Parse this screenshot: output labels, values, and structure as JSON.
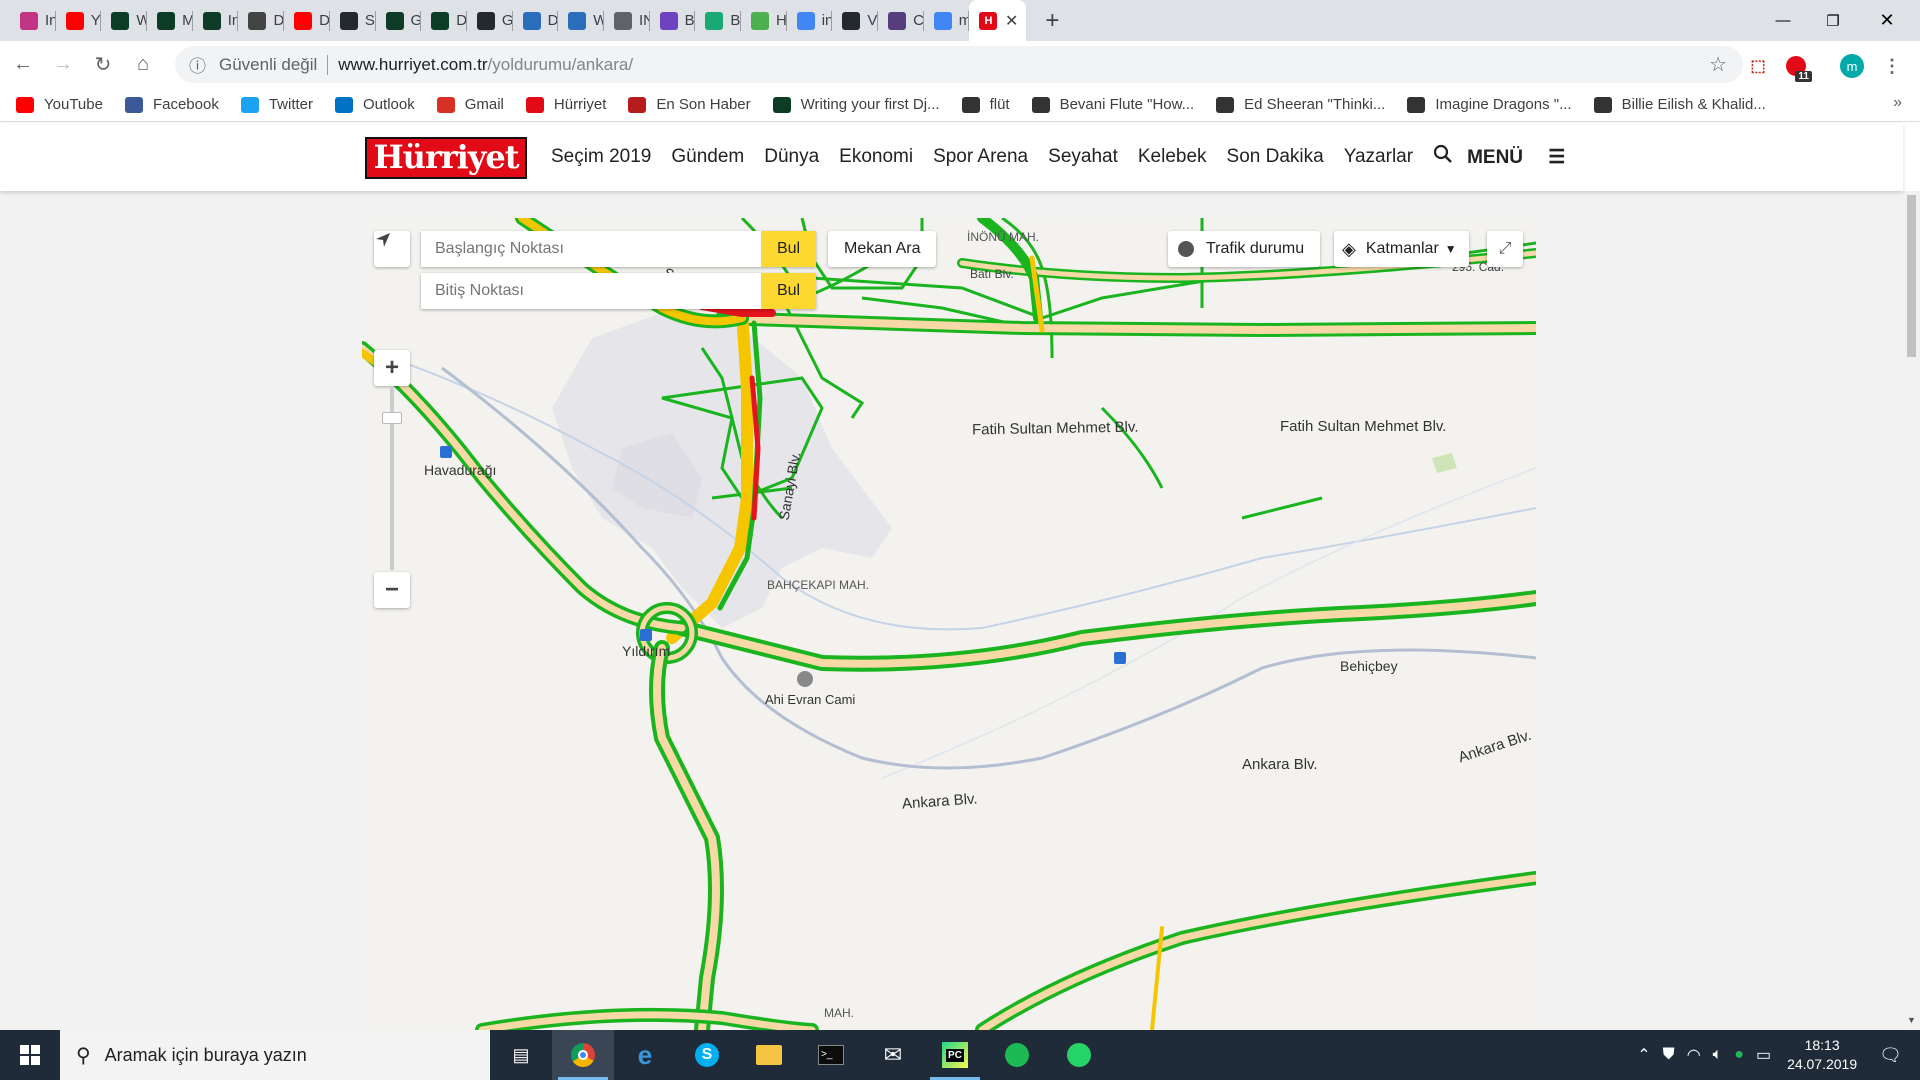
{
  "browser": {
    "tabs": [
      {
        "label": "Inst",
        "icon": "instagram-icon",
        "color": "#c13584"
      },
      {
        "label": "You",
        "icon": "youtube-icon",
        "color": "#ff0000"
      },
      {
        "label": "Wri",
        "icon": "django-icon",
        "color": "#0c3c26"
      },
      {
        "label": "Ma",
        "icon": "django-icon",
        "color": "#0c3c26"
      },
      {
        "label": "Intr",
        "icon": "django-icon",
        "color": "#0c3c26"
      },
      {
        "label": "Dja",
        "icon": "book-icon",
        "color": "#444444"
      },
      {
        "label": "Dja",
        "icon": "youtube-icon",
        "color": "#ff0000"
      },
      {
        "label": "Sou",
        "icon": "github-icon",
        "color": "#24292e"
      },
      {
        "label": "Ger",
        "icon": "django-icon",
        "color": "#0c3c26"
      },
      {
        "label": "Dja",
        "icon": "django-docs-icon",
        "color": "#0c3c26"
      },
      {
        "label": "Gitl",
        "icon": "github-icon",
        "color": "#24292e"
      },
      {
        "label": "Dirt",
        "icon": "hand-icon",
        "color": "#2a6ebb"
      },
      {
        "label": "Wh",
        "icon": "hand-icon",
        "color": "#2a6ebb"
      },
      {
        "label": "INT",
        "icon": "globe-icon",
        "color": "#5f6368"
      },
      {
        "label": "Boo",
        "icon": "bootstrap-s-icon",
        "color": "#6f42c1"
      },
      {
        "label": "Boo",
        "icon": "shield-green-icon",
        "color": "#19a974"
      },
      {
        "label": "Hov",
        "icon": "tag-green-icon",
        "color": "#4caf50"
      },
      {
        "label": "inte",
        "icon": "google-icon",
        "color": "#4285f4"
      },
      {
        "label": "Vib",
        "icon": "github-icon",
        "color": "#24292e"
      },
      {
        "label": "Cor",
        "icon": "bootstrap-b-icon",
        "color": "#563d7c"
      },
      {
        "label": "mar",
        "icon": "google-icon",
        "color": "#4285f4"
      }
    ],
    "active_tab": {
      "icon": "hurriyet-icon",
      "color": "#e30a17"
    },
    "address": {
      "security": "Güvenli değil",
      "host": "www.hurriyet.com.tr",
      "path": "/yoldurumu/ankara/"
    },
    "extension_badge": "11",
    "profile_initial": "m",
    "bookmarks": [
      {
        "label": "YouTube",
        "icon": "youtube-icon",
        "color": "#ff0000"
      },
      {
        "label": "Facebook",
        "icon": "facebook-icon",
        "color": "#3b5998"
      },
      {
        "label": "Twitter",
        "icon": "twitter-icon",
        "color": "#1da1f2"
      },
      {
        "label": "Outlook",
        "icon": "outlook-icon",
        "color": "#0072c6"
      },
      {
        "label": "Gmail",
        "icon": "gmail-icon",
        "color": "#d93025"
      },
      {
        "label": "Hürriyet",
        "icon": "hurriyet-icon",
        "color": "#e30a17"
      },
      {
        "label": "En Son Haber",
        "icon": "news-icon",
        "color": "#b71c1c"
      },
      {
        "label": "Writing your first Dj...",
        "icon": "django-icon",
        "color": "#0c3c26"
      },
      {
        "label": "flüt",
        "icon": "music-icon",
        "color": "#333333"
      },
      {
        "label": "Bevani Flute \"How...",
        "icon": "music-icon",
        "color": "#333333"
      },
      {
        "label": "Ed Sheeran \"Thinki...",
        "icon": "music-icon",
        "color": "#333333"
      },
      {
        "label": "Imagine Dragons \"...",
        "icon": "music-icon",
        "color": "#333333"
      },
      {
        "label": "Billie Eilish & Khalid...",
        "icon": "music-icon",
        "color": "#333333"
      }
    ]
  },
  "site": {
    "logo": "Hürriyet",
    "nav": [
      "Seçim 2019",
      "Gündem",
      "Dünya",
      "Ekonomi",
      "Spor Arena",
      "Seyahat",
      "Kelebek",
      "Son Dakika",
      "Yazarlar"
    ],
    "menu_label": "MENÜ"
  },
  "map": {
    "start_placeholder": "Başlangıç Noktası",
    "end_placeholder": "Bitiş Noktası",
    "find_label": "Bul",
    "place_search": "Mekan Ara",
    "traffic": "Trafik durumu",
    "layers": "Katmanlar",
    "labels": {
      "inonu": "İNÖNÜ MAH.",
      "havaduragi": "Havadurağı",
      "yildirim": "Yıldırım",
      "bahcekapi": "BAHÇEKAPI MAH.",
      "ahi_evran": "Ahi Evran Cami",
      "behicbey": "Behiçbey",
      "fatih1": "Fatih Sultan Mehmet Blv.",
      "fatih2": "Fatih Sultan Mehmet Blv.",
      "ankara1": "Ankara Blv.",
      "ankara2": "Ankara Blv.",
      "ankara3": "Ankara Blv.",
      "bati": "Batı Blv.",
      "sanayi": "Sanayi Blv.",
      "sultan": "Sultan Mehmet",
      "mah_bottom": "MAH.",
      "cad_295": "295. Cad."
    },
    "traffic_colors": {
      "free": "#1ab41e",
      "slow": "#f5c500",
      "jam": "#e3141b",
      "road": "#f7d9a8"
    }
  },
  "taskbar": {
    "search_placeholder": "Aramak için buraya yazın",
    "time": "18:13",
    "date": "24.07.2019"
  }
}
